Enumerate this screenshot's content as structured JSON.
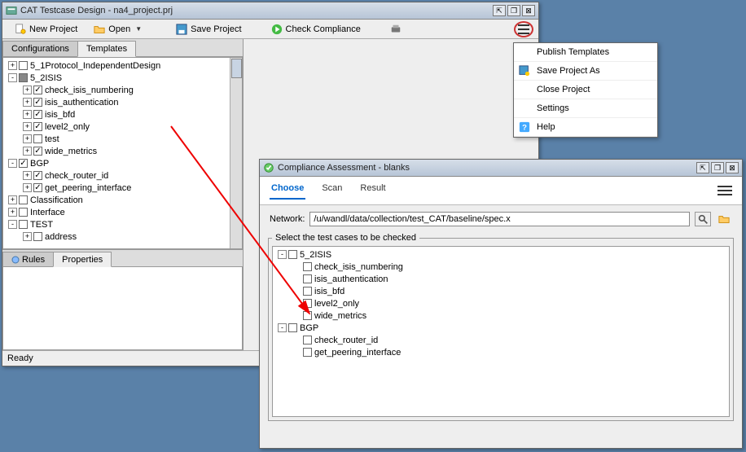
{
  "main": {
    "title": "CAT Testcase Design - na4_project.prj",
    "toolbar": {
      "new_project": "New Project",
      "open": "Open",
      "save_project": "Save Project",
      "check": "Check Compliance"
    },
    "tabs": {
      "conf": "Configurations",
      "tmpl": "Templates"
    },
    "tree": [
      {
        "ind": 0,
        "tog": "+",
        "chk": "off",
        "label": "5_1Protocol_IndependentDesign"
      },
      {
        "ind": 0,
        "tog": "-",
        "chk": "half",
        "label": "5_2ISIS"
      },
      {
        "ind": 1,
        "tog": "+",
        "chk": "on",
        "label": "check_isis_numbering"
      },
      {
        "ind": 1,
        "tog": "+",
        "chk": "on",
        "label": "isis_authentication"
      },
      {
        "ind": 1,
        "tog": "+",
        "chk": "on",
        "label": "isis_bfd"
      },
      {
        "ind": 1,
        "tog": "+",
        "chk": "on",
        "label": "level2_only"
      },
      {
        "ind": 1,
        "tog": "+",
        "chk": "off",
        "label": "test"
      },
      {
        "ind": 1,
        "tog": "+",
        "chk": "on",
        "label": "wide_metrics"
      },
      {
        "ind": 0,
        "tog": "-",
        "chk": "on",
        "label": "BGP"
      },
      {
        "ind": 1,
        "tog": "+",
        "chk": "on",
        "label": "check_router_id"
      },
      {
        "ind": 1,
        "tog": "+",
        "chk": "on",
        "label": "get_peering_interface"
      },
      {
        "ind": 0,
        "tog": "+",
        "chk": "off",
        "label": "Classification"
      },
      {
        "ind": 0,
        "tog": "+",
        "chk": "off",
        "label": "Interface"
      },
      {
        "ind": 0,
        "tog": "-",
        "chk": "off",
        "label": "TEST"
      },
      {
        "ind": 1,
        "tog": "+",
        "chk": "off",
        "label": "address"
      }
    ],
    "btabs": {
      "rules": "Rules",
      "props": "Properties"
    },
    "status": "Ready"
  },
  "menu": {
    "publish": "Publish Templates",
    "save_as": "Save Project As",
    "close": "Close Project",
    "settings": "Settings",
    "help": "Help"
  },
  "dlg": {
    "title": "Compliance Assessment - blanks",
    "tabs": {
      "choose": "Choose",
      "scan": "Scan",
      "result": "Result"
    },
    "network_label": "Network:",
    "network_value": "/u/wandl/data/collection/test_CAT/baseline/spec.x",
    "legend": "Select the test cases to be checked",
    "tree": [
      {
        "ind": 0,
        "tog": "-",
        "chk": "off",
        "label": "5_2ISIS"
      },
      {
        "ind": 1,
        "tog": "",
        "chk": "off",
        "label": "check_isis_numbering"
      },
      {
        "ind": 1,
        "tog": "",
        "chk": "off",
        "label": "isis_authentication"
      },
      {
        "ind": 1,
        "tog": "",
        "chk": "off",
        "label": "isis_bfd"
      },
      {
        "ind": 1,
        "tog": "",
        "chk": "off",
        "label": "level2_only"
      },
      {
        "ind": 1,
        "tog": "",
        "chk": "off",
        "label": "wide_metrics"
      },
      {
        "ind": 0,
        "tog": "-",
        "chk": "off",
        "label": "BGP"
      },
      {
        "ind": 1,
        "tog": "",
        "chk": "off",
        "label": "check_router_id"
      },
      {
        "ind": 1,
        "tog": "",
        "chk": "off",
        "label": "get_peering_interface"
      }
    ]
  }
}
